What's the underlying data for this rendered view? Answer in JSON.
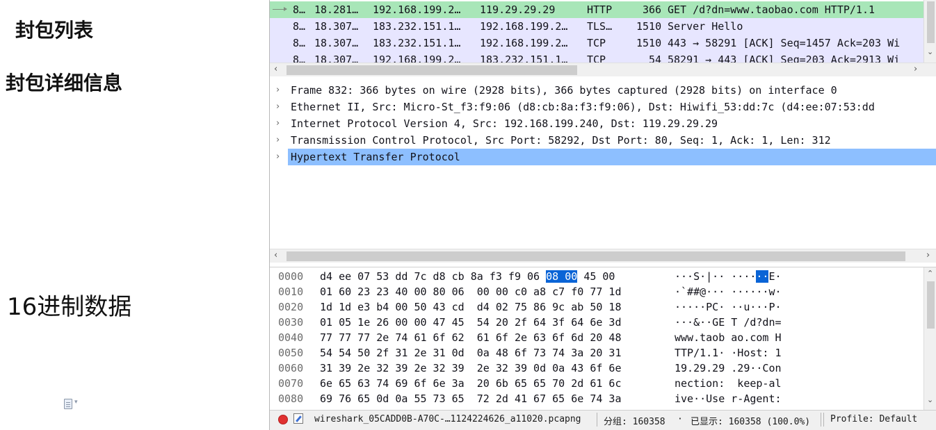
{
  "labels": {
    "packet_list": "封包列表",
    "packet_details": "封包详细信息",
    "hex_data": "16进制数据"
  },
  "packet_list": {
    "rows": [
      {
        "no": "8…",
        "time": "18.281…",
        "src": "192.168.199.2…",
        "dst": "119.29.29.29",
        "proto": "HTTP",
        "len": "366",
        "info": "GET /d?dn=www.taobao.com HTTP/1.1",
        "kind": "http",
        "selected": true
      },
      {
        "no": "8…",
        "time": "18.307…",
        "src": "183.232.151.1…",
        "dst": "192.168.199.2…",
        "proto": "TLS…",
        "len": "1510",
        "info": "Server Hello",
        "kind": "tcp",
        "selected": false
      },
      {
        "no": "8…",
        "time": "18.307…",
        "src": "183.232.151.1…",
        "dst": "192.168.199.2…",
        "proto": "TCP",
        "len": "1510",
        "info": "443 → 58291 [ACK] Seq=1457 Ack=203 Wi",
        "kind": "tcp",
        "selected": false
      },
      {
        "no": "8…",
        "time": "18.307…",
        "src": "192.168.199.2…",
        "dst": "183.232.151.1…",
        "proto": "TCP",
        "len": "54",
        "info": "58291 → 443 [ACK] Seq=203 Ack=2913 Wi",
        "kind": "tcp",
        "selected": false
      }
    ]
  },
  "details": {
    "rows": [
      {
        "text": "Frame 832: 366 bytes on wire (2928 bits), 366 bytes captured (2928 bits) on interface 0",
        "selected": false
      },
      {
        "text": "Ethernet II, Src: Micro-St_f3:f9:06 (d8:cb:8a:f3:f9:06), Dst: Hiwifi_53:dd:7c (d4:ee:07:53:dd",
        "selected": false
      },
      {
        "text": "Internet Protocol Version 4, Src: 192.168.199.240, Dst: 119.29.29.29",
        "selected": false
      },
      {
        "text": "Transmission Control Protocol, Src Port: 58292, Dst Port: 80, Seq: 1, Ack: 1, Len: 312",
        "selected": false
      },
      {
        "text": "Hypertext Transfer Protocol",
        "selected": true
      }
    ]
  },
  "hex": {
    "rows": [
      {
        "offset": "0000",
        "bytes_a": "d4 ee 07 53 dd 7c d8 cb",
        "bytes_b": "8a f3 f9 06",
        "bytes_hl": "08 00",
        "bytes_c": "45 00",
        "ascii_a": "···S·|·· ····",
        "ascii_hl": "··",
        "ascii_c": "E·"
      },
      {
        "offset": "0010",
        "bytes": "01 60 23 23 40 00 80 06  00 00 c0 a8 c7 f0 77 1d",
        "ascii": "·`##@··· ······w·"
      },
      {
        "offset": "0020",
        "bytes": "1d 1d e3 b4 00 50 43 cd  d4 02 75 86 9c ab 50 18",
        "ascii": "·····PC· ··u···P·"
      },
      {
        "offset": "0030",
        "bytes": "01 05 1e 26 00 00 47 45  54 20 2f 64 3f 64 6e 3d",
        "ascii": "···&··GE T /d?dn="
      },
      {
        "offset": "0040",
        "bytes": "77 77 77 2e 74 61 6f 62  61 6f 2e 63 6f 6d 20 48",
        "ascii": "www.taob ao.com H"
      },
      {
        "offset": "0050",
        "bytes": "54 54 50 2f 31 2e 31 0d  0a 48 6f 73 74 3a 20 31",
        "ascii": "TTP/1.1· ·Host: 1"
      },
      {
        "offset": "0060",
        "bytes": "31 39 2e 32 39 2e 32 39  2e 32 39 0d 0a 43 6f 6e",
        "ascii": "19.29.29 .29··Con"
      },
      {
        "offset": "0070",
        "bytes": "6e 65 63 74 69 6f 6e 3a  20 6b 65 65 70 2d 61 6c",
        "ascii": "nection:  keep-al"
      },
      {
        "offset": "0080",
        "bytes": "69 76 65 0d 0a 55 73 65  72 2d 41 67 65 6e 74 3a",
        "ascii": "ive··Use r-Agent:"
      }
    ]
  },
  "status": {
    "file": "wireshark_05CADD0B-A70C-…1124224626_a11020.pcapng",
    "packets": "分组: 160358",
    "dot": "·",
    "displayed": "已显示: 160358 (100.0%)",
    "profile": "Profile: Default"
  },
  "icons": {
    "expand": "chevron-right-icon",
    "record": "record-icon",
    "edit": "edit-capture-comment-icon",
    "doc": "document-icon"
  },
  "colors": {
    "http_selected": "#a8e6b8",
    "tcp_row": "#e7e6ff",
    "detail_selected": "#8dbfff",
    "hex_highlight": "#0a64d6"
  }
}
